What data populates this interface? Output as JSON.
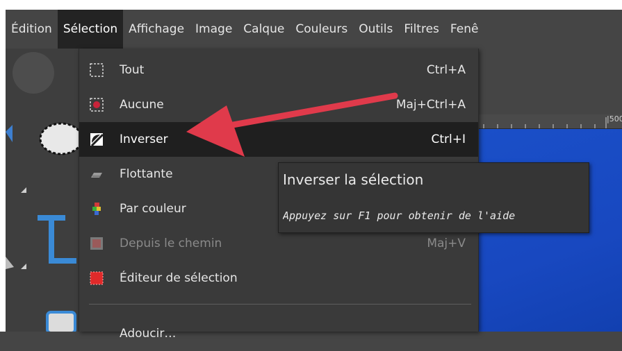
{
  "menubar": {
    "items": [
      "Édition",
      "Sélection",
      "Affichage",
      "Image",
      "Calque",
      "Couleurs",
      "Outils",
      "Filtres",
      "Fenê"
    ],
    "active": "Sélection"
  },
  "ruler": {
    "mark": "|500"
  },
  "selection_menu": {
    "items": [
      {
        "label": "Tout",
        "shortcut": "Ctrl+A",
        "icon": "select-all-icon"
      },
      {
        "label": "Aucune",
        "shortcut": "Maj+Ctrl+A",
        "icon": "select-none-icon"
      },
      {
        "label": "Inverser",
        "shortcut": "Ctrl+I",
        "icon": "invert-selection-icon"
      },
      {
        "label": "Flottante",
        "shortcut": "",
        "icon": "float-selection-icon"
      },
      {
        "label": "Par couleur",
        "shortcut": "",
        "icon": "select-by-color-icon"
      },
      {
        "label": "Depuis le chemin",
        "shortcut": "Maj+V",
        "icon": "path-to-selection-icon"
      },
      {
        "label": "Éditeur de sélection",
        "shortcut": "",
        "icon": "selection-editor-icon"
      },
      {
        "label": "Adoucir…",
        "shortcut": "",
        "icon": ""
      }
    ],
    "highlighted": "Inverser",
    "disabled": [
      "Depuis le chemin"
    ]
  },
  "tooltip": {
    "title": "Inverser la sélection",
    "help": "Appuyez sur F1 pour obtenir de l'aide"
  },
  "colors": {
    "arrow": "#e03a4b",
    "canvas": "#1a4fc8",
    "menu_bg": "#3a3a3a",
    "highlight_bg": "#1f1f1f"
  }
}
